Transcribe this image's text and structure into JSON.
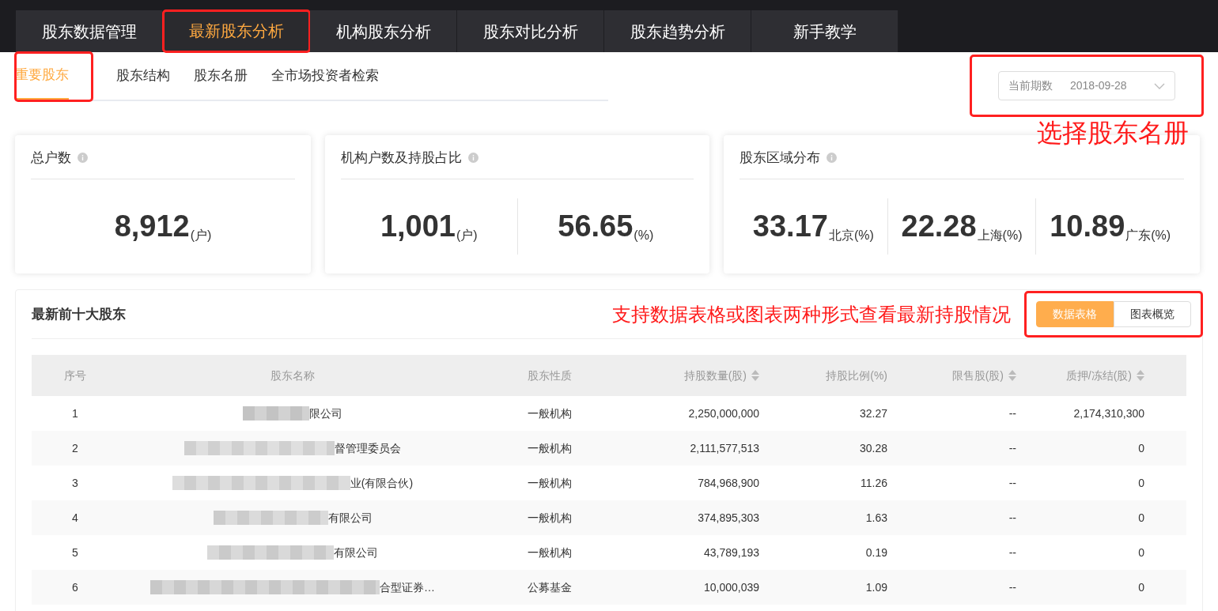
{
  "top_tabs": [
    {
      "label": "股东数据管理",
      "selected": false,
      "highlighted": false
    },
    {
      "label": "最新股东分析",
      "selected": true,
      "highlighted": true
    },
    {
      "label": "机构股东分析",
      "selected": false,
      "highlighted": false
    },
    {
      "label": "股东对比分析",
      "selected": false,
      "highlighted": false
    },
    {
      "label": "股东趋势分析",
      "selected": false,
      "highlighted": false
    },
    {
      "label": "新手教学",
      "selected": false,
      "highlighted": false
    }
  ],
  "sub_tabs": [
    {
      "label": "重要股东",
      "selected": true,
      "highlighted": true
    },
    {
      "label": "股东结构",
      "selected": false,
      "highlighted": false
    },
    {
      "label": "股东名册",
      "selected": false,
      "highlighted": false
    },
    {
      "label": "全市场投资者检索",
      "selected": false,
      "highlighted": false
    }
  ],
  "period_select": {
    "label": "当前期数",
    "value": "2018-09-28",
    "highlighted": true,
    "note": "选择股东名册"
  },
  "stat_cards": [
    {
      "title": "总户数",
      "values": [
        {
          "number": "8,912",
          "unit": "(户)"
        }
      ]
    },
    {
      "title": "机构户数及持股占比",
      "values": [
        {
          "number": "1,001",
          "unit": "(户)"
        },
        {
          "number": "56.65",
          "unit": "(%)"
        }
      ]
    },
    {
      "title": "股东区域分布",
      "values": [
        {
          "number": "33.17",
          "unit": "北京(%)"
        },
        {
          "number": "22.28",
          "unit": "上海(%)"
        },
        {
          "number": "10.89",
          "unit": "广东(%)"
        }
      ]
    }
  ],
  "table": {
    "title": "最新前十大股东",
    "note": "支持数据表格或图表两种形式查看最新持股情况",
    "view_toggle": {
      "highlighted": true,
      "options": [
        {
          "label": "数据表格",
          "selected": true
        },
        {
          "label": "图表概览",
          "selected": false
        }
      ]
    },
    "columns": [
      {
        "label": "序号",
        "sortable": false
      },
      {
        "label": "股东名称",
        "sortable": false
      },
      {
        "label": "股东性质",
        "sortable": false
      },
      {
        "label": "持股数量(股)",
        "sortable": true
      },
      {
        "label": "持股比例(%)",
        "sortable": false
      },
      {
        "label": "限售股(股)",
        "sortable": true
      },
      {
        "label": "质押/冻结(股)",
        "sortable": true
      }
    ],
    "rows": [
      {
        "index": "1",
        "name": "限公司",
        "redacted": true,
        "nature": "一般机构",
        "shares": "2,250,000,000",
        "ratio": "32.27",
        "restricted": "--",
        "pledged": "2,174,310,300"
      },
      {
        "index": "2",
        "name": "督管理委员会",
        "redacted": true,
        "nature": "一般机构",
        "shares": "2,111,577,513",
        "ratio": "30.28",
        "restricted": "--",
        "pledged": "0"
      },
      {
        "index": "3",
        "name": "业(有限合伙)",
        "redacted": true,
        "nature": "一般机构",
        "shares": "784,968,900",
        "ratio": "11.26",
        "restricted": "--",
        "pledged": "0"
      },
      {
        "index": "4",
        "name": "有限公司",
        "redacted": true,
        "nature": "一般机构",
        "shares": "374,895,303",
        "ratio": "1.63",
        "restricted": "--",
        "pledged": "0"
      },
      {
        "index": "5",
        "name": "有限公司",
        "redacted": true,
        "nature": "一般机构",
        "shares": "43,789,193",
        "ratio": "0.19",
        "restricted": "--",
        "pledged": "0"
      },
      {
        "index": "6",
        "name": "合型证券…",
        "redacted": true,
        "nature": "公募基金",
        "shares": "10,000,039",
        "ratio": "1.09",
        "restricted": "--",
        "pledged": "0"
      }
    ]
  }
}
